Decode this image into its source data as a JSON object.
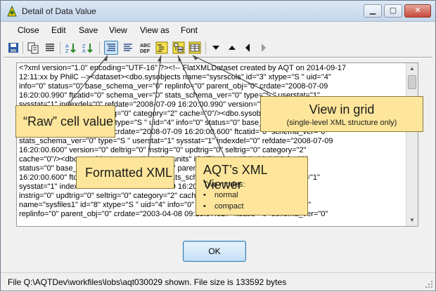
{
  "window": {
    "title": "Detail of Data Value",
    "controls": {
      "minimize": "▁",
      "maximize": "▢",
      "close": "✕"
    }
  },
  "menu": [
    {
      "label": "Close"
    },
    {
      "label": "Edit"
    },
    {
      "label": "Save"
    },
    {
      "label": "View"
    },
    {
      "label": "View as"
    },
    {
      "label": "Font"
    }
  ],
  "toolbar": {
    "buttons": [
      {
        "icon": "save-icon"
      },
      {
        "icon": "copy-icon"
      },
      {
        "icon": "wrap-icon"
      },
      {
        "icon": "sort-ascending-icon"
      },
      {
        "icon": "sort-descending-icon"
      },
      {
        "icon": "raw-view-icon",
        "active": true
      },
      {
        "icon": "formatted-view-icon"
      },
      {
        "icon": "abc-def-icon",
        "text": "ABC\nDEF"
      },
      {
        "icon": "formatted-xml-icon"
      },
      {
        "icon": "xml-viewer-icon"
      },
      {
        "icon": "grid-view-icon"
      },
      {
        "icon": "arrow-down-icon"
      },
      {
        "icon": "arrow-up-icon"
      },
      {
        "icon": "arrow-left-icon"
      },
      {
        "icon": "arrow-right-icon"
      }
    ]
  },
  "content": {
    "lines": [
      "<?xml version=\"1.0\" encoding=\"UTF-16\" ?><!-- FlatXMLDataset created by AQT on 2014-09-17",
      "12:11:xx by PhilC --><dataset><dbo.sysobjects name=\"sysrscols\" id=\"3\" xtype=\"S \" uid=\"4\"",
      "info=\"0\" status=\"0\" base_schema_ver=\"0\" replinfo=\"0\" parent_obj=\"0\" crdate=\"2008-07-09",
      "16:20:00.990\" ftcatid=\"0\" schema_ver=\"0\" stats_schema_ver=\"0\" type=\"S \" userstat=\"1\"",
      "sysstat=\"1\" indexdel=\"0\" refdate=\"2008-07-09 16:20:00.990\" version=\"0\" deltrig=\"0\"",
      "instrig=\"0\" updtrig=\"0\" seltrig=\"0\" category=\"2\" cache=\"0\"/><dbo.sysobjects",
      "name=\"sysrowsets\" id=\"5\" xtype=\"S \" uid=\"4\" info=\"0\" status=\"0\" base_schema_ver=\"0\"",
      "replinfo=\"0\" parent_obj=\"0\" crdate=\"2008-07-09 16:20:00.600\" ftcatid=\"0\" schema_ver=\"0\"",
      "stats_schema_ver=\"0\" type=\"S \" userstat=\"1\" sysstat=\"1\" indexdel=\"0\" refdate=\"2008-07-09",
      "16:20:00.600\" version=\"0\" deltrig=\"0\" instrig=\"0\" updtrig=\"0\" seltrig=\"0\" category=\"2\"",
      "cache=\"0\"/><dbo.sysobjects name=\"sysallocunits\" id=\"7\" xtype=\"S \" uid=\"4\" info=\"0\"",
      "status=\"0\" base_schema_ver=\"0\" replinfo=\"0\" parent_obj=\"0\" crdate=\"2008-07-09",
      "16:20:00.600\" ftcatid=\"0\" schema_ver=\"0\" stats_schema_ver=\"0\" type=\"S \" userstat=\"1\"",
      "sysstat=\"1\" indexdel=\"0\" refdate=\"2008-07-09 16:20:00.600\" version=\"0\" deltrig=\"0\"",
      "instrig=\"0\" updtrig=\"0\" seltrig=\"0\" category=\"2\" cache=\"0\"/><dbo.sysobjects",
      "name=\"sysfiles1\" id=\"8\" xtype=\"S \" uid=\"4\" info=\"0\" status=\"0\" base_schema_ver=\"0\"",
      "replinfo=\"0\" parent_obj=\"0\" crdate=\"2003-04-08 09:13:37.827\" ftcatid=\"0\" schema_ver=\"0\""
    ]
  },
  "callouts": {
    "raw": {
      "title": "“Raw” cell value"
    },
    "grid": {
      "title": "View in grid",
      "subtitle": "(single-level XML structure only)"
    },
    "formatted": {
      "title": "Formatted XML"
    },
    "viewer": {
      "title": "AQT’s XML Viewer",
      "subtitle": "Two modes:",
      "modes": [
        "normal",
        "compact"
      ]
    },
    "bullet": "•"
  },
  "ok_label": "OK",
  "status": "File Q:\\AQTDev\\workfiles\\lobs\\aqt030029 shown. File size is 133592 bytes",
  "colors": {
    "callout_fill": "#fde69b",
    "active_button": "#cde4f7",
    "accent": "#3c7fb1"
  }
}
